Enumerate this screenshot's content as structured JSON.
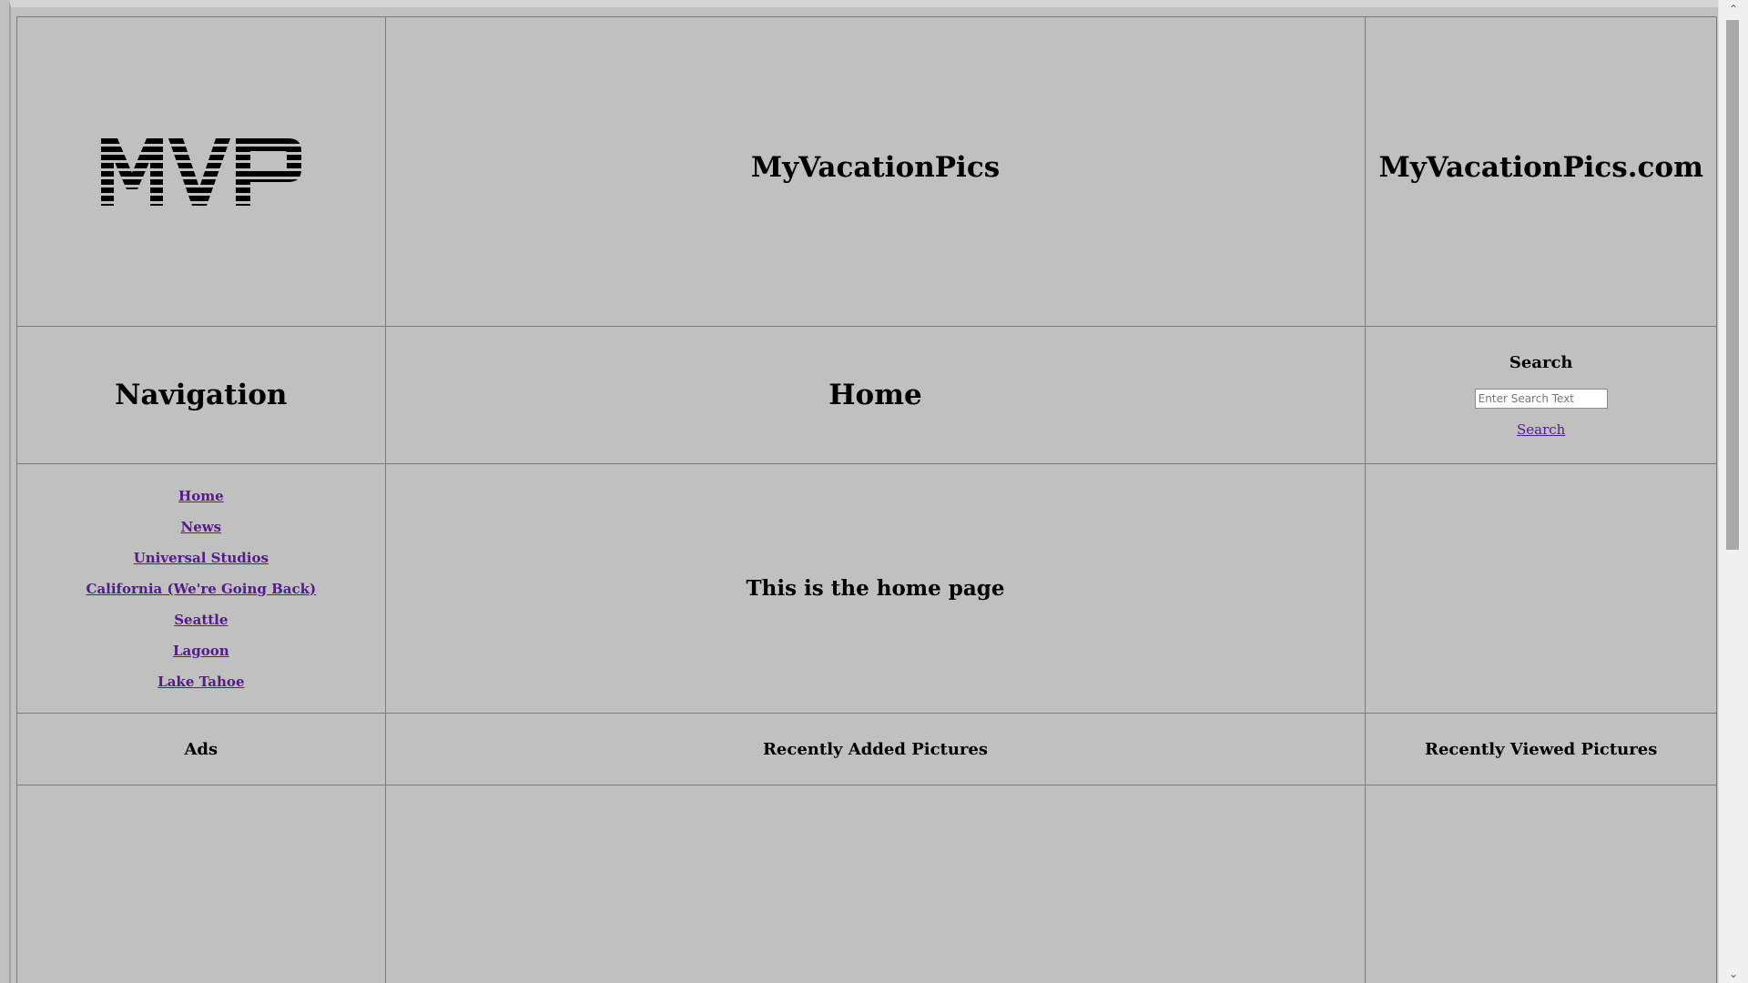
{
  "header": {
    "logo_text": "MVP",
    "site_name": "MyVacationPics",
    "domain": "MyVacationPics.com"
  },
  "subheader": {
    "navigation_title": "Navigation",
    "page_title": "Home",
    "search": {
      "heading": "Search",
      "placeholder": "Enter Search Text",
      "value": "",
      "link_label": "Search"
    }
  },
  "navigation": {
    "items": [
      {
        "label": "Home"
      },
      {
        "label": "News"
      },
      {
        "label": "Universal Studios"
      },
      {
        "label": "California (We're Going Back)"
      },
      {
        "label": "Seattle"
      },
      {
        "label": "Lagoon"
      },
      {
        "label": "Lake Tahoe"
      }
    ]
  },
  "main": {
    "message": "This is the home page"
  },
  "sections": {
    "ads": "Ads",
    "recently_added": "Recently Added Pictures",
    "recently_viewed": "Recently Viewed Pictures"
  },
  "scrollbar": {
    "up_icon": "chevron-up-icon",
    "down_icon": "chevron-down-icon"
  }
}
